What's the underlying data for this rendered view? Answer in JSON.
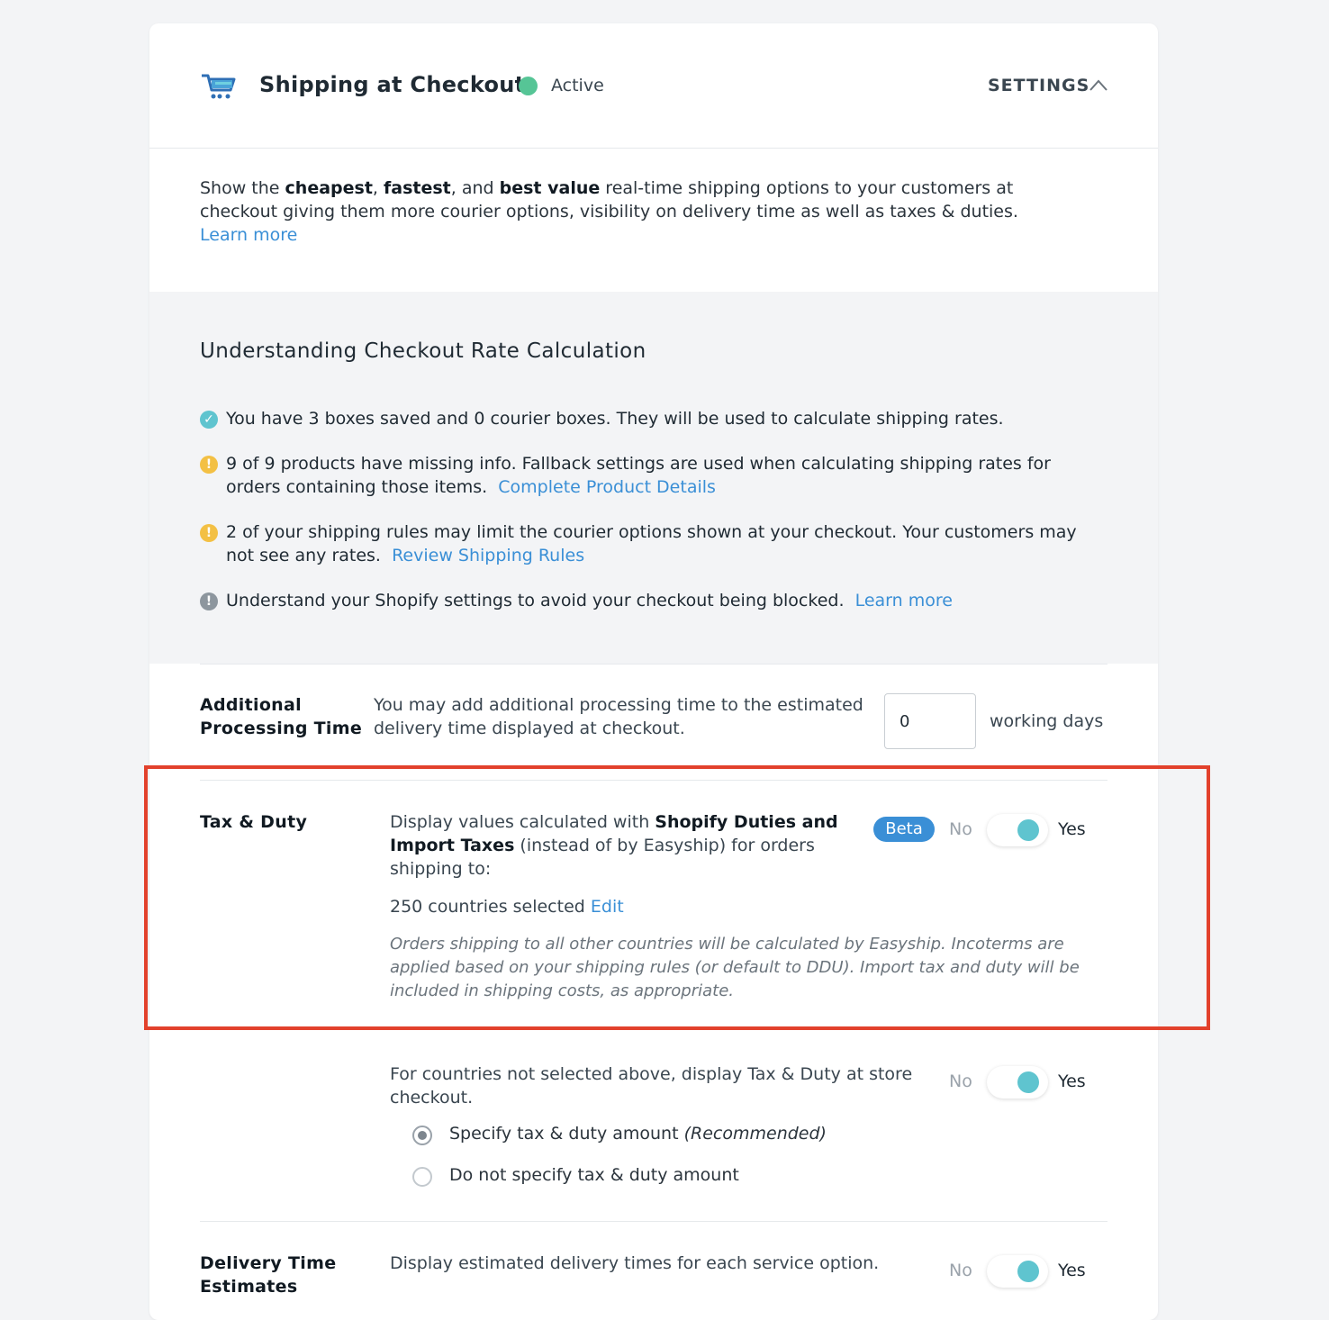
{
  "header": {
    "title": "Shipping at Checkout",
    "status": "Active",
    "settings_label": "SETTINGS",
    "icons": [
      "cart-icon",
      "chevron-up-icon"
    ]
  },
  "intro": {
    "p1": "Show the ",
    "b1": "cheapest",
    "p2": ", ",
    "b2": "fastest",
    "p3": ", and ",
    "b3": "best value",
    "p4": " real-time shipping options to your customers at checkout giving them more courier options, visibility on delivery time as well as taxes & duties.",
    "learn_more": "Learn more"
  },
  "calc": {
    "heading": "Understanding Checkout Rate Calculation",
    "items": [
      {
        "icon": "check-circle-icon",
        "text": "You have 3 boxes saved and 0 courier boxes. They will be used to calculate shipping rates.",
        "link": ""
      },
      {
        "icon": "warning-icon",
        "text": "9 of 9 products have missing info. Fallback settings are used when calculating shipping rates for orders containing those items.",
        "link": "Complete Product Details"
      },
      {
        "icon": "warning-icon",
        "text": "2 of your shipping rules may limit the courier options shown at your checkout. Your customers may not see any rates.",
        "link": "Review Shipping Rules"
      },
      {
        "icon": "info-icon",
        "text": "Understand your Shopify settings to avoid your checkout being blocked.",
        "link": "Learn more"
      }
    ]
  },
  "processing": {
    "label_line1": "Additional",
    "label_line2": "Processing Time",
    "description": "You may add additional processing time to the estimated delivery time displayed at checkout.",
    "value": "0",
    "unit": "working days"
  },
  "tax": {
    "label": "Tax & Duty",
    "desc_prefix": "Display values calculated with ",
    "desc_bold": "Shopify Duties and Import Taxes",
    "desc_suffix": " (instead of by Easyship) for orders shipping to:",
    "badge": "Beta",
    "no": "No",
    "yes": "Yes",
    "toggle_on": true,
    "countries": "250 countries selected",
    "edit": "Edit",
    "note": "Orders shipping to all other countries will be calculated by Easyship. Incoterms are applied based on your shipping rules (or default to DDU). Import tax and duty will be included in shipping costs, as appropriate."
  },
  "store_checkout": {
    "description": "For countries not selected above, display Tax & Duty at store checkout.",
    "no": "No",
    "yes": "Yes",
    "toggle_on": true,
    "options": [
      {
        "label": "Specify tax & duty amount",
        "suffix": "(Recommended)",
        "selected": true
      },
      {
        "label": "Do not specify tax & duty amount",
        "suffix": "",
        "selected": false
      }
    ]
  },
  "delivery": {
    "label_line1": "Delivery Time",
    "label_line2": "Estimates",
    "description": "Display estimated delivery times for each service option.",
    "no": "No",
    "yes": "Yes",
    "toggle_on": true
  },
  "colors": {
    "accent": "#3a8fd6",
    "active": "#56c596",
    "toggle": "#5fc4cf",
    "warning": "#f3c044",
    "highlight": "#e2412c"
  }
}
